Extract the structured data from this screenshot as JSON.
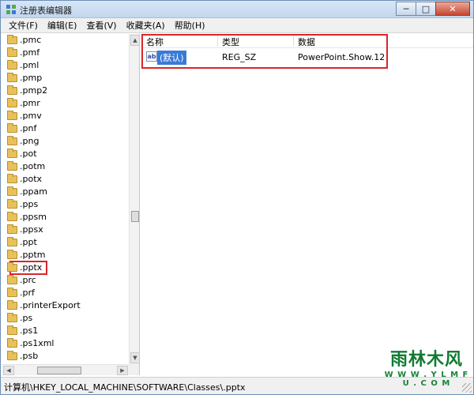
{
  "window": {
    "title": "注册表编辑器",
    "buttons": {
      "minimize": "─",
      "maximize": "□",
      "close": "✕"
    }
  },
  "menu": [
    "文件(F)",
    "编辑(E)",
    "查看(V)",
    "收藏夹(A)",
    "帮助(H)"
  ],
  "tree": {
    "items": [
      ".pmc",
      ".pmf",
      ".pml",
      ".pmp",
      ".pmp2",
      ".pmr",
      ".pmv",
      ".pnf",
      ".png",
      ".pot",
      ".potm",
      ".potx",
      ".ppam",
      ".pps",
      ".ppsm",
      ".ppsx",
      ".ppt",
      ".pptm",
      ".pptx",
      ".prc",
      ".prf",
      ".printerExport",
      ".ps",
      ".ps1",
      ".ps1xml",
      ".psb"
    ],
    "selected": ".pptx"
  },
  "values": {
    "columns": {
      "name": "名称",
      "type": "类型",
      "data": "数据"
    },
    "rows": [
      {
        "name": "(默认)",
        "type": "REG_SZ",
        "data": "PowerPoint.Show.12"
      }
    ]
  },
  "status": {
    "path": "计算机\\HKEY_LOCAL_MACHINE\\SOFTWARE\\Classes\\.pptx"
  },
  "watermark": {
    "logo": "雨林木风",
    "url": "W W W . Y L M F U . C O M"
  },
  "colors": {
    "highlight": "#d9262c",
    "selection": "#3a7ad8",
    "folder": "#e9c15a"
  }
}
